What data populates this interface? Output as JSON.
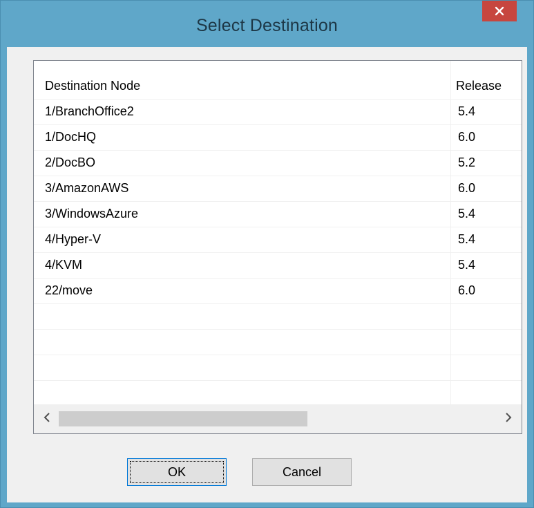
{
  "window": {
    "title": "Select Destination",
    "close_label": "close-icon"
  },
  "list": {
    "columns": [
      "Destination Node",
      "Release"
    ],
    "rows": [
      {
        "node": "1/BranchOffice2",
        "release": "5.4"
      },
      {
        "node": "1/DocHQ",
        "release": "6.0"
      },
      {
        "node": "2/DocBO",
        "release": "5.2"
      },
      {
        "node": "3/AmazonAWS",
        "release": "6.0"
      },
      {
        "node": "3/WindowsAzure",
        "release": "5.4"
      },
      {
        "node": "4/Hyper-V",
        "release": "5.4"
      },
      {
        "node": "4/KVM",
        "release": "5.4"
      },
      {
        "node": "22/move",
        "release": "6.0"
      }
    ]
  },
  "buttons": {
    "ok_label": "OK",
    "cancel_label": "Cancel"
  },
  "colors": {
    "titlebar": "#5fa7c9",
    "close": "#c7463f",
    "client": "#f0f0f0"
  }
}
